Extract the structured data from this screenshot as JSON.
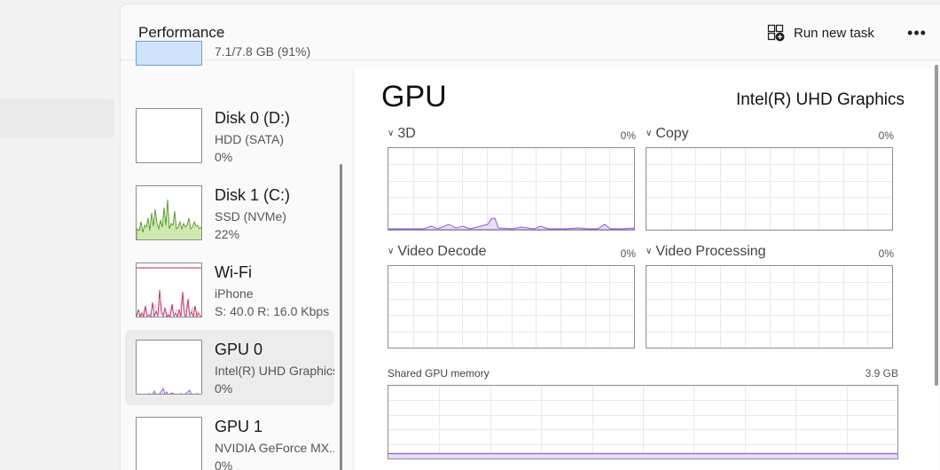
{
  "header": {
    "title": "Performance",
    "run_task_label": "Run new task",
    "more_label": "•••"
  },
  "resources": {
    "memory_partial": {
      "value": "7.1/7.8 GB (91%)"
    },
    "disk0": {
      "name": "Disk 0 (D:)",
      "type": "HDD (SATA)",
      "value": "0%"
    },
    "disk1": {
      "name": "Disk 1 (C:)",
      "type": "SSD (NVMe)",
      "value": "22%"
    },
    "wifi": {
      "name": "Wi-Fi",
      "network": "iPhone",
      "value": "S: 40.0  R: 16.0 Kbps"
    },
    "gpu0": {
      "name": "GPU 0",
      "model": "Intel(R) UHD Graphics",
      "value": "0%"
    },
    "gpu1": {
      "name": "GPU 1",
      "model": "NVIDIA GeForce MX...",
      "value": "0%"
    }
  },
  "detail": {
    "title": "GPU",
    "model": "Intel(R) UHD Graphics",
    "engines": [
      {
        "label": "3D",
        "percent": "0%"
      },
      {
        "label": "Copy",
        "percent": "0%"
      },
      {
        "label": "Video Decode",
        "percent": "0%"
      },
      {
        "label": "Video Processing",
        "percent": "0%"
      }
    ],
    "shared_memory": {
      "label": "Shared GPU memory",
      "value": "3.9 GB"
    }
  },
  "colors": {
    "gpu_line": "#8e5fcf",
    "gpu_fill": "#e8defa",
    "disk_line": "#4d8a1c",
    "disk_fill": "#cfe8b0",
    "wifi_line": "#b5275f",
    "memory_fill": "#cfe3fb",
    "grid": "#e9e9e9"
  }
}
